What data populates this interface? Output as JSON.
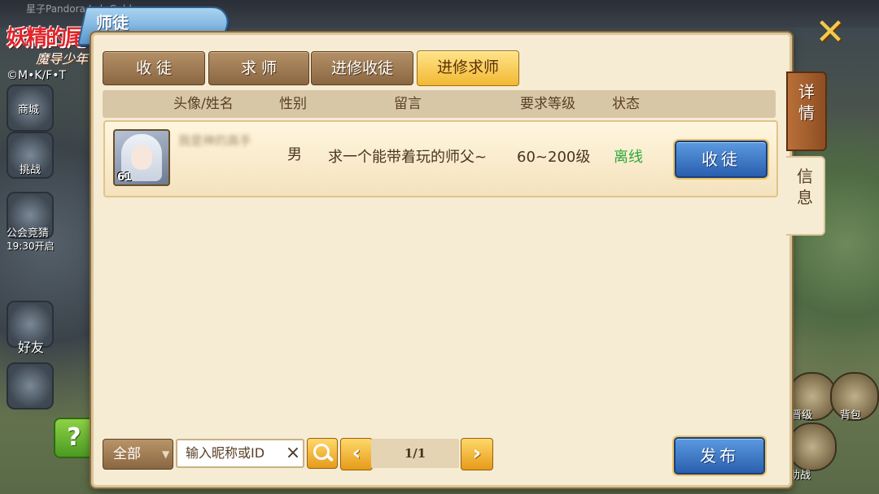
{
  "background": {
    "topbar_text": "星子Pandora Lab Gold",
    "logo": {
      "line1": "妖精的尾巴",
      "line2": "魔导少年",
      "line3": "©M•K/F•T"
    },
    "left_labels": [
      "商城",
      "挑战",
      "公会竞猜",
      "19:30开启",
      "好友"
    ],
    "right_labels": [
      "晋级",
      "背包",
      "助战"
    ]
  },
  "dialog": {
    "title": "师徒",
    "tabs": [
      {
        "label": "收 徒",
        "active": false
      },
      {
        "label": "求 师",
        "active": false
      },
      {
        "label": "进修收徒",
        "active": false
      },
      {
        "label": "进修求师",
        "active": true
      }
    ],
    "side_tabs": {
      "detail": "详\n情",
      "info": "信\n息"
    },
    "columns": [
      "头像/姓名",
      "性别",
      "留言",
      "要求等级",
      "状态"
    ],
    "rows": [
      {
        "level": "61",
        "name": "我是神的高手",
        "gender": "男",
        "message": "求一个能带着玩的师父~",
        "required_level": "60~200级",
        "status": "离线",
        "status_color": "#2ea83a",
        "action_label": "收徒"
      }
    ],
    "footer": {
      "filter_label": "全部",
      "search_placeholder": "输入昵称或ID",
      "clear_icon": "×",
      "prev_icon": "‹",
      "next_icon": "›",
      "page_display": "1/1",
      "publish_label": "发布"
    },
    "close_icon": "✕"
  },
  "help_icon": "?"
}
